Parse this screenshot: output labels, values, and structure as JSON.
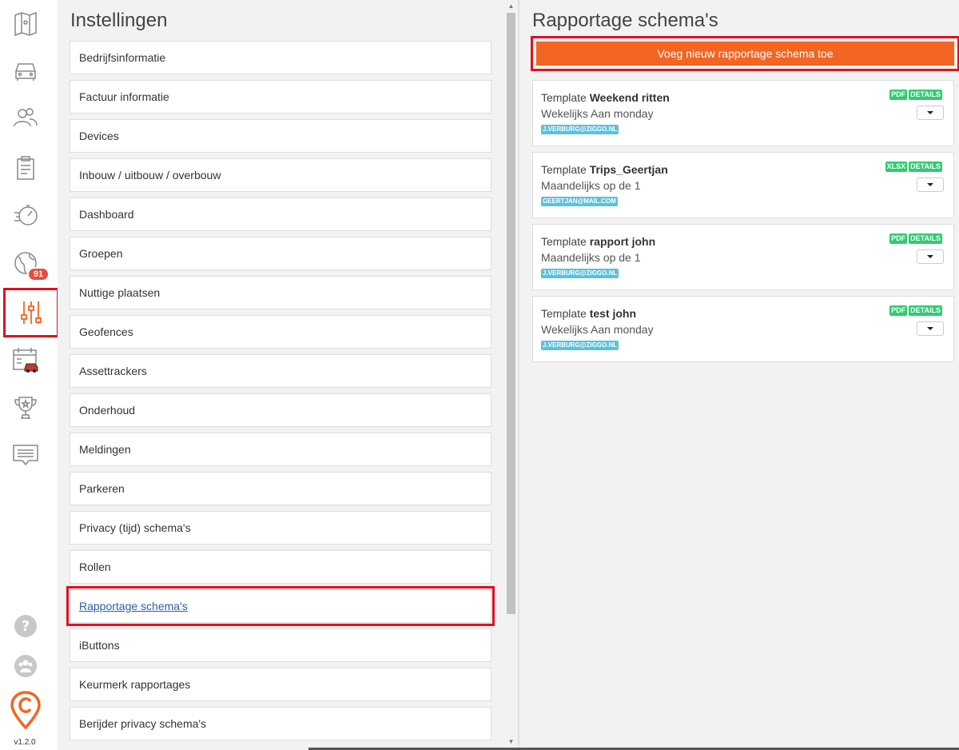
{
  "rail": {
    "badge_count": "91",
    "version": "v1.2.0",
    "active_color": "#f36522",
    "icons": [
      "map-icon",
      "car-icon",
      "users-icon",
      "clipboard-icon",
      "speedometer-icon",
      "globe-icon",
      "sliders-icon",
      "calendar-car-icon",
      "trophy-icon",
      "chat-icon",
      "help-icon",
      "group-icon",
      "logo-icon"
    ]
  },
  "settings": {
    "title": "Instellingen",
    "items": [
      "Bedrijfsinformatie",
      "Factuur informatie",
      "Devices",
      "Inbouw / uitbouw / overbouw",
      "Dashboard",
      "Groepen",
      "Nuttige plaatsen",
      "Geofences",
      "Assettrackers",
      "Onderhoud",
      "Meldingen",
      "Parkeren",
      "Privacy (tijd) schema's",
      "Rollen",
      "Rapportage schema's",
      "iButtons",
      "Keurmerk rapportages",
      "Berijder privacy schema's"
    ],
    "selected_index": 14
  },
  "reports": {
    "title": "Rapportage schema's",
    "add_label": "Voeg nieuw rapportage schema toe",
    "template_prefix": "Template",
    "cards": [
      {
        "name": "Weekend ritten",
        "schedule": "Wekelijks Aan monday",
        "email": "J.VERBURG@ZIGGO.NL",
        "format": "PDF",
        "details": "DETAILS"
      },
      {
        "name": "Trips_Geertjan",
        "schedule": "Maandelijks op de 1",
        "email": "GEERTJAN@MAIL.COM",
        "format": "XLSX",
        "details": "DETAILS"
      },
      {
        "name": "rapport john",
        "schedule": "Maandelijks op de 1",
        "email": "J.VERBURG@ZIGGO.NL",
        "format": "PDF",
        "details": "DETAILS"
      },
      {
        "name": "test john",
        "schedule": "Wekelijks Aan monday",
        "email": "J.VERBURG@ZIGGO.NL",
        "format": "PDF",
        "details": "DETAILS"
      }
    ]
  },
  "colors": {
    "accent": "#f36522",
    "highlight": "#e3101f",
    "tag_green": "#2ecc71",
    "tag_blue": "#5bc0de"
  }
}
